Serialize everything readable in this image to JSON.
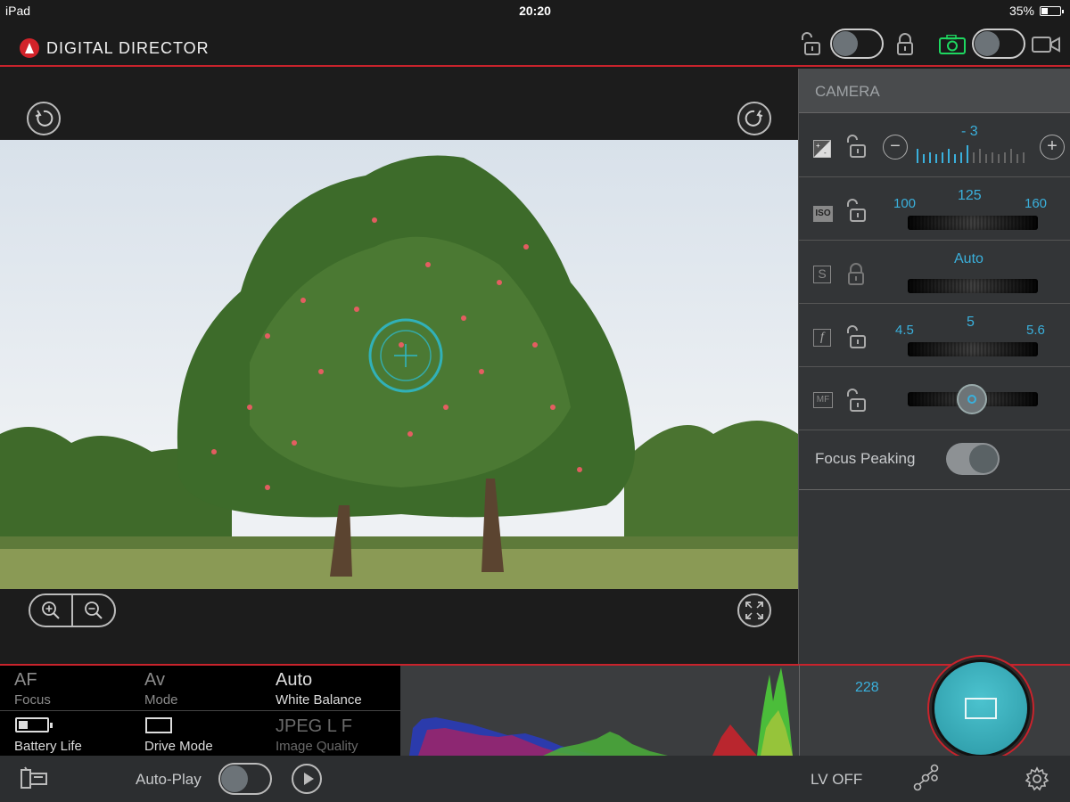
{
  "status_bar": {
    "device": "iPad",
    "time": "20:20",
    "battery": "35%",
    "battery_level": 0.35
  },
  "header": {
    "app_title": "DIGITAL DIRECTOR",
    "lock_toggle_on": false,
    "mode_toggle_on": false,
    "accent_color": "#c8232c",
    "camera_icon_color": "#1ed760"
  },
  "panel": {
    "title": "CAMERA",
    "exposure": {
      "value": "- 3",
      "minus": "−",
      "plus": "+"
    },
    "iso": {
      "icon": "ISO",
      "prev": "100",
      "value": "125",
      "next": "160"
    },
    "shutter": {
      "icon": "S",
      "value": "Auto"
    },
    "aperture": {
      "icon": "f",
      "prev": "4.5",
      "value": "5",
      "next": "5.6"
    },
    "focus": {
      "icon": "MF"
    },
    "focus_peaking": {
      "label": "Focus Peaking",
      "on": true
    },
    "value_color": "#3ab0dc"
  },
  "info": {
    "focus": {
      "value": "AF",
      "label": "Focus"
    },
    "mode": {
      "value": "Av",
      "label": "Mode"
    },
    "white_balance": {
      "value": "Auto",
      "label": "White Balance"
    },
    "battery": {
      "label": "Battery Life",
      "level": 0.3
    },
    "drive": {
      "label": "Drive Mode"
    },
    "quality": {
      "value": "JPEG L F",
      "label": "Image Quality"
    }
  },
  "shots_remaining": "228",
  "bottom_bar": {
    "autoplay_label": "Auto-Play",
    "autoplay_on": false,
    "lv_label": "LV OFF"
  }
}
